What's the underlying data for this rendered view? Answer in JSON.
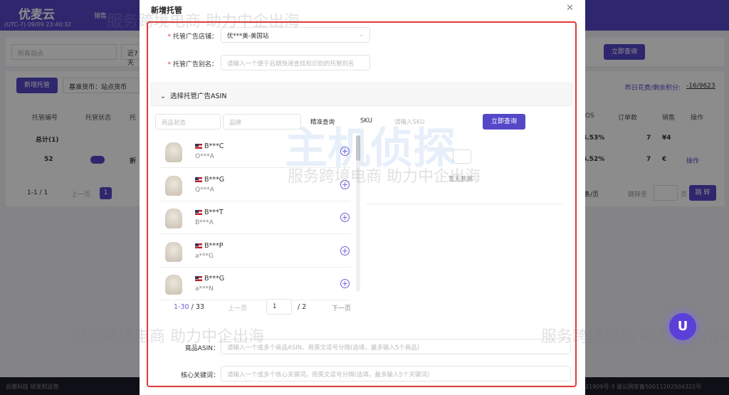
{
  "app": {
    "logo": "优麦云",
    "timezone": "(UTC-7) 09/09 23:40:32",
    "nav_item": "销售"
  },
  "filters": {
    "site_placeholder": "所有站点",
    "date_range": "近7天",
    "query_button": "立即查询"
  },
  "toolbar": {
    "add_button": "新增托管",
    "currency": "基准货币：站点货币",
    "credit_label": "昨日花费/剩余积分:",
    "credit_value": "-16/9623"
  },
  "table": {
    "headers": [
      "托管编号",
      "托管状态",
      "托",
      "OS",
      "订单数",
      "销售",
      "操作"
    ],
    "total_row": {
      "label": "总计(1)",
      "acos": "6.53%",
      "orders": "7",
      "sales": "¥4"
    },
    "rows": [
      {
        "id": "52",
        "enabled": true,
        "name": "折",
        "acos": "6.52%",
        "orders": "7",
        "sales": "€",
        "action": "操作"
      }
    ]
  },
  "pagination": {
    "range": "1-1 / 1",
    "prev": "上一页",
    "page": "1",
    "per_page": "条/页",
    "goto": "跳转至",
    "page_unit": "页",
    "jump": "跳 转"
  },
  "footer": {
    "left": "云雅科技 研发和运营",
    "right": "21909号-3   渝公网安备50011202504322号"
  },
  "modal": {
    "title": "新增托管",
    "store_label": "托管广告店铺：",
    "store_value": "优***美-美国站",
    "alias_label": "托管广告别名：",
    "alias_placeholder": "请输入一个便于后期快速查找和识别的托管别名",
    "section_title": "选择托管广告ASIN",
    "status_placeholder": "商品状态",
    "brand_placeholder": "品牌",
    "match_mode": "精准查询",
    "search_field": "SKU",
    "sku_placeholder": "请输入SKU",
    "query_button": "立即查询",
    "items": [
      {
        "asin": "B***C",
        "sub": "O***A"
      },
      {
        "asin": "B***G",
        "sub": "Q***A"
      },
      {
        "asin": "B***T",
        "sub": "B***A"
      },
      {
        "asin": "B***P",
        "sub": "a***G"
      },
      {
        "asin": "B***G",
        "sub": "a***N"
      }
    ],
    "list_pagination": {
      "range": "1-30",
      "total": "/ 33",
      "prev": "上一页",
      "page": "1",
      "pages": "/  2",
      "next": "下一页"
    },
    "empty_text": "暂无数据",
    "competitor_label": "竟品ASIN：",
    "competitor_placeholder": "请输入一个或多个竟品ASIN，用英文逗号分隔(选填，最多输入5个竟品)",
    "keyword_label": "核心关键词：",
    "keyword_placeholder": "请输入一个或多个核心关键词，用英文逗号分隔(选填，最多输入5个关键词)"
  },
  "watermark": {
    "brand": "主机侦探",
    "slogan": "服务跨境电商 助力中企出海"
  },
  "colors": {
    "primary": "#5548c8",
    "highlight": "#e03a3a"
  }
}
